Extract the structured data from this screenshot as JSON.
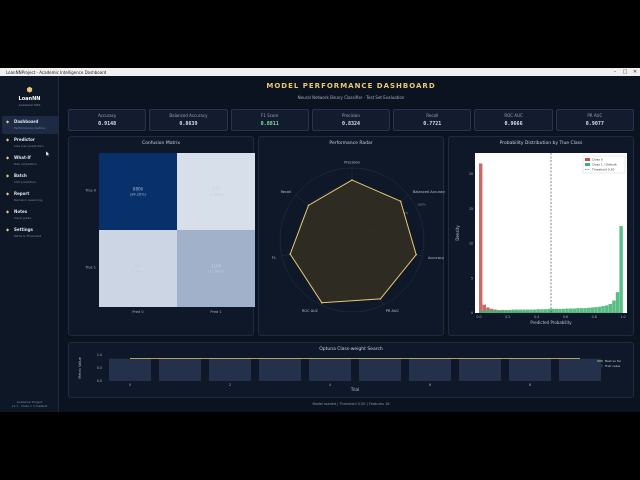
{
  "window": {
    "title": "LoanNNProject - Academic Intelligence Dashboard"
  },
  "brand": {
    "name": "LoanNN",
    "tagline": "Academic DSS"
  },
  "nav": [
    {
      "label": "Dashboard",
      "desc": "Performance metrics",
      "icon": "grid-icon",
      "glyph": "◆"
    },
    {
      "label": "Predictor",
      "desc": "Live loan prediction",
      "icon": "predict-icon",
      "glyph": "◆"
    },
    {
      "label": "What-If",
      "desc": "Risk simulation",
      "icon": "flask-icon",
      "glyph": "◆"
    },
    {
      "label": "Batch",
      "desc": "CSV prediction",
      "icon": "batch-icon",
      "glyph": "◆"
    },
    {
      "label": "Report",
      "desc": "Decision reasoning",
      "icon": "report-icon",
      "glyph": "◆"
    },
    {
      "label": "Notes",
      "desc": "Input guide",
      "icon": "notes-icon",
      "glyph": "◆"
    },
    {
      "label": "Settings",
      "desc": "Paths & Threshold",
      "icon": "gear-icon",
      "glyph": "◆"
    }
  ],
  "footer": {
    "line1": "Academic Project",
    "line2": "v1.1 · Class 1 = Default"
  },
  "header": {
    "title": "MODEL PERFORMANCE DASHBOARD",
    "subtitle": "Neural Network Binary Classifier · Test Set Evaluation"
  },
  "metrics": [
    {
      "label": "Accuracy",
      "value": "0.9148"
    },
    {
      "label": "Balanced Accuracy",
      "value": "0.8639"
    },
    {
      "label": "F1 Score",
      "value": "0.8811"
    },
    {
      "label": "Precision",
      "value": "0.8324"
    },
    {
      "label": "Recall",
      "value": "0.7721"
    },
    {
      "label": "ROC AUC",
      "value": "0.9666"
    },
    {
      "label": "PR AUC",
      "value": "0.9077"
    }
  ],
  "confusion": {
    "title": "Confusion Matrix",
    "row_labels": [
      "True 0",
      "True 1"
    ],
    "col_labels": [
      "Pred 0",
      "Pred 1"
    ],
    "cells": [
      {
        "count": "8806",
        "pct": "(84.28%)"
      },
      {
        "count": "171",
        "pct": "(1.64%)"
      },
      {
        "count": "305",
        "pct": "(2.92%)"
      },
      {
        "count": "1166",
        "pct": "(11.16%)"
      }
    ]
  },
  "radar": {
    "title": "Performance Radar",
    "axes": [
      "Precision",
      "Balanced Accuracy",
      "Accuracy",
      "PR AUC",
      "ROC AUC",
      "F1",
      "Recall"
    ],
    "values": [
      0.8324,
      0.8639,
      0.9148,
      0.9077,
      0.9666,
      0.8811,
      0.7721
    ],
    "ring_labels": [
      "25%",
      "50%",
      "75%",
      "100%"
    ]
  },
  "dist": {
    "title": "Probability Distribution by True Class",
    "xlabel": "Predicted Probability",
    "ylabel": "Density",
    "xticks": [
      "0.0",
      "0.2",
      "0.4",
      "0.6",
      "0.8",
      "1.0"
    ],
    "yticks": [
      "0",
      "5",
      "10",
      "15",
      "20"
    ],
    "legend": [
      "Class 0",
      "Class 1 / Default",
      "Threshold 0.50"
    ]
  },
  "optuna": {
    "title": "Optuna Class-weight Search",
    "xlabel": "Trial",
    "ylabel": "Metric Value",
    "yticks": [
      "0.0",
      "0.5",
      "1.0"
    ],
    "xticks": [
      "0",
      "2",
      "4",
      "6",
      "8"
    ],
    "legend": [
      "Best so far",
      "Trial value"
    ]
  },
  "status": "Model loaded | Threshold 0.50 | Features 16",
  "chart_data": [
    {
      "type": "heatmap",
      "title": "Confusion Matrix",
      "x": [
        "Pred 0",
        "Pred 1"
      ],
      "y": [
        "True 0",
        "True 1"
      ],
      "values": [
        [
          8806,
          171
        ],
        [
          305,
          1166
        ]
      ]
    },
    {
      "type": "radar",
      "title": "Performance Radar",
      "categories": [
        "Precision",
        "Balanced Accuracy",
        "Accuracy",
        "PR AUC",
        "ROC AUC",
        "F1",
        "Recall"
      ],
      "values": [
        0.8324,
        0.8639,
        0.9148,
        0.9077,
        0.9666,
        0.8811,
        0.7721
      ],
      "ylim": [
        0,
        1
      ]
    },
    {
      "type": "histogram",
      "title": "Probability Distribution by True Class",
      "xlabel": "Predicted Probability",
      "ylabel": "Density",
      "xlim": [
        0,
        1
      ],
      "ylim": [
        0,
        23
      ],
      "bin_centers": [
        0.0125,
        0.0375,
        0.0625,
        0.0875,
        0.1125,
        0.1375,
        0.1625,
        0.1875,
        0.2125,
        0.2375,
        0.2625,
        0.2875,
        0.3125,
        0.3375,
        0.3625,
        0.3875,
        0.4125,
        0.4375,
        0.4625,
        0.4875,
        0.5125,
        0.5375,
        0.5625,
        0.5875,
        0.6125,
        0.6375,
        0.6625,
        0.6875,
        0.7125,
        0.7375,
        0.7625,
        0.7875,
        0.8125,
        0.8375,
        0.8625,
        0.8875,
        0.9125,
        0.9375,
        0.9625,
        0.9875
      ],
      "series": [
        {
          "name": "Class 0",
          "color": "#c0504d",
          "values": [
            21.5,
            1.2,
            0.8,
            0.6,
            0.5,
            0.4,
            0.35,
            0.3,
            0.3,
            0.25,
            0.25,
            0.2,
            0.2,
            0.2,
            0.15,
            0.15,
            0.15,
            0.15,
            0.12,
            0.12,
            0.1,
            0.1,
            0.1,
            0.1,
            0.1,
            0.08,
            0.08,
            0.08,
            0.08,
            0.08,
            0.06,
            0.06,
            0.06,
            0.06,
            0.06,
            0.05,
            0.05,
            0.05,
            0.05,
            0.05
          ]
        },
        {
          "name": "Class 1 / Default",
          "color": "#3cb371",
          "values": [
            0.3,
            0.4,
            0.4,
            0.4,
            0.4,
            0.4,
            0.45,
            0.45,
            0.45,
            0.5,
            0.5,
            0.5,
            0.5,
            0.5,
            0.5,
            0.5,
            0.55,
            0.55,
            0.55,
            0.6,
            0.6,
            0.6,
            0.6,
            0.6,
            0.65,
            0.65,
            0.65,
            0.7,
            0.7,
            0.7,
            0.75,
            0.8,
            0.85,
            0.9,
            1.0,
            1.1,
            1.3,
            1.8,
            3.0,
            12.5
          ]
        }
      ],
      "threshold": 0.5
    },
    {
      "type": "bar",
      "title": "Optuna Class-weight Search",
      "xlabel": "Trial",
      "ylabel": "Metric Value",
      "categories": [
        0,
        1,
        2,
        3,
        4,
        5,
        6,
        7,
        8,
        9
      ],
      "series": [
        {
          "name": "Trial value",
          "values": [
            0.86,
            0.86,
            0.86,
            0.86,
            0.86,
            0.86,
            0.86,
            0.86,
            0.86,
            0.86
          ]
        },
        {
          "name": "Best so far",
          "values": [
            0.87,
            0.87,
            0.87,
            0.87,
            0.87,
            0.87,
            0.87,
            0.87,
            0.87,
            0.87
          ]
        }
      ],
      "ylim": [
        0,
        1
      ]
    }
  ]
}
